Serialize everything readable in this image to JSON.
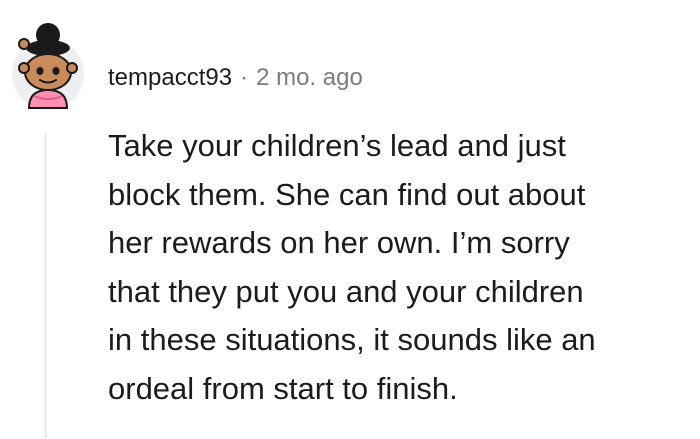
{
  "comment": {
    "avatar_icon": "snoo-avatar-icon",
    "author": "tempacct93",
    "separator": "·",
    "timestamp": "2 mo. ago",
    "body_lines": [
      "Take your children’s lead and just",
      "block them. She can find out about",
      "her rewards on her own. I’m sorry",
      "that they put you and your children",
      "in these situations, it sounds like an",
      "ordeal from start to finish."
    ]
  },
  "colors": {
    "text": "#1c1c1c",
    "meta": "#7c7c7c",
    "thread_line": "#edeff1",
    "avatar_bg": "#edeff1",
    "avatar_shirt": "#ff8fb1",
    "avatar_face": "#c98b5c"
  }
}
